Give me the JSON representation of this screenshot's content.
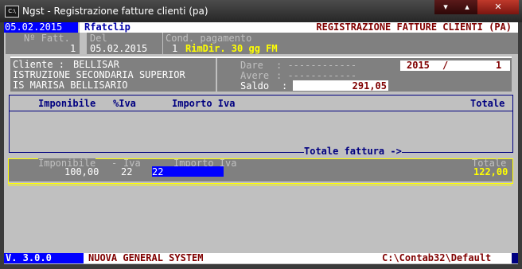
{
  "window": {
    "title": "Ngst - Registrazione fatture clienti (pa)",
    "icon_text": "C:\\",
    "buttons": {
      "minimize": "▾",
      "maximize": "▴",
      "close": "✕"
    }
  },
  "header": {
    "date": "05.02.2015",
    "program": "Rfatclip",
    "doc_title": "REGISTRAZIONE FATTURE CLIENTI (PA)"
  },
  "invoice": {
    "num_label": "Nº Fatt.",
    "num_value": "1",
    "date_label": "Del",
    "date_value": "05.02.2015",
    "payment_label": "Cond. pagamento",
    "payment_code": "1",
    "payment_desc": "RimDir. 30 gg FM"
  },
  "client": {
    "label": "Cliente :",
    "name": "BELLISAR",
    "line1": "ISTRUZIONE SECONDARIA SUPERIOR",
    "line2": "IS MARISA BELLISARIO"
  },
  "balance": {
    "dare_label": "Dare",
    "dare_value": ": ------------",
    "avere_label": "Avere",
    "avere_value": ": ------------",
    "saldo_label": "Saldo",
    "saldo_colon": ":",
    "saldo_value": "291,05",
    "year": "2015",
    "slash": "/",
    "protocol": "1"
  },
  "vat_table": {
    "headers": [
      "Imponibile",
      "%Iva",
      "Importo Iva",
      "Totale"
    ],
    "total_label": "Totale fattura ->"
  },
  "entry": {
    "labels": {
      "imponibile": "Imponibile",
      "iva": "Iva",
      "importo_iva": "Importo Iva",
      "totale": "Totale"
    },
    "imponibile": "100,00",
    "iva": "22",
    "importo_iva": "22",
    "totale": "122,00"
  },
  "status": {
    "version": "V. 3.0.0",
    "system": "NUOVA GENERAL SYSTEM",
    "path": "C:\\Contab32\\Default"
  },
  "colors": {
    "console_bg": "#c0c0c0",
    "blue": "#0000ff",
    "navy": "#000080",
    "maroon": "#800000",
    "yellow": "#ffff00"
  }
}
